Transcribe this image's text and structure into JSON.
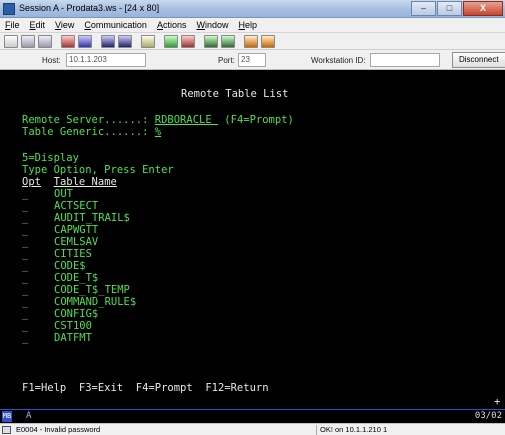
{
  "window": {
    "title": "Session A - Prodata3.ws - [24 x 80]",
    "controls": [
      "–",
      "□",
      "X"
    ]
  },
  "menu": {
    "items": [
      {
        "acc": "F",
        "rest": "ile"
      },
      {
        "acc": "E",
        "rest": "dit"
      },
      {
        "acc": "V",
        "rest": "iew"
      },
      {
        "acc": "C",
        "rest": "ommunication"
      },
      {
        "acc": "A",
        "rest": "ctions"
      },
      {
        "acc": "W",
        "rest": "indow"
      },
      {
        "acc": "H",
        "rest": "elp"
      }
    ]
  },
  "connection": {
    "host_label": "Host:",
    "host_value": "10.1.1.203",
    "port_label": "Port:",
    "port_value": "23",
    "workstation_label": "Workstation ID:",
    "workstation_value": "",
    "disconnect_label": "Disconnect"
  },
  "screen": {
    "title": "Remote Table List",
    "remote_server_label": "Remote Server......: ",
    "remote_server_value": "RDBORACLE ",
    "remote_server_hint": " (F4=Prompt)",
    "table_generic_label": "Table Generic......: ",
    "table_generic_value": "%",
    "option_hint": "5=Display",
    "instruction": "Type Option, Press Enter",
    "col_opt": "Opt",
    "col_table": "Table Name",
    "rows": [
      {
        "opt": "_",
        "name": "OUT"
      },
      {
        "opt": "_",
        "name": "ACTSECT"
      },
      {
        "opt": "_",
        "name": "AUDIT_TRAIL$"
      },
      {
        "opt": "_",
        "name": "CAPWGTT"
      },
      {
        "opt": "_",
        "name": "CEMLSAV"
      },
      {
        "opt": "_",
        "name": "CITIES"
      },
      {
        "opt": "_",
        "name": "CODE$"
      },
      {
        "opt": "_",
        "name": "CODE_T$"
      },
      {
        "opt": "_",
        "name": "CODE_T$_TEMP"
      },
      {
        "opt": "_",
        "name": "COMMAND_RULE$"
      },
      {
        "opt": "_",
        "name": "CONFIG$"
      },
      {
        "opt": "_",
        "name": "CST100"
      },
      {
        "opt": "_",
        "name": "DATFMT"
      }
    ],
    "more_indicator": "+",
    "function_keys": "F1=Help  F3=Exit  F4=Prompt  F12=Return"
  },
  "oia": {
    "mode": "MB",
    "indicator": "A",
    "cursor_pos": "03/02"
  },
  "status": {
    "message": "E0004 - Invalid password",
    "connection": "OK! on 10.1.1.210 1"
  },
  "colors": {
    "terminal_bg": "#000000",
    "terminal_green": "#4ee04e",
    "terminal_white": "#e8e8e8",
    "oia_blue": "#3050d0"
  }
}
